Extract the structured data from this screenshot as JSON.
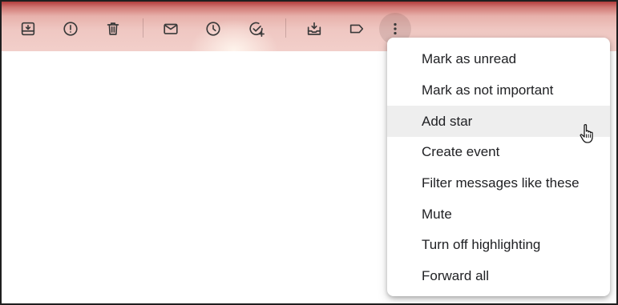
{
  "toolbar": {
    "buttons": [
      {
        "name": "archive-icon"
      },
      {
        "name": "report-spam-icon"
      },
      {
        "name": "delete-icon"
      },
      {
        "name": "mark-unread-icon"
      },
      {
        "name": "snooze-icon"
      },
      {
        "name": "add-to-tasks-icon"
      },
      {
        "name": "move-to-icon"
      },
      {
        "name": "label-icon"
      },
      {
        "name": "more-options-icon"
      }
    ]
  },
  "menu": {
    "items": [
      {
        "label": "Mark as unread"
      },
      {
        "label": "Mark as not important"
      },
      {
        "label": "Add star"
      },
      {
        "label": "Create event"
      },
      {
        "label": "Filter messages like these"
      },
      {
        "label": "Mute"
      },
      {
        "label": "Turn off highlighting"
      },
      {
        "label": "Forward all"
      }
    ],
    "hovered_index": 2
  },
  "cursor": {
    "type": "hand-pointer-icon"
  },
  "colors": {
    "toolbar_top": "#b33d3d",
    "toolbar_bottom": "#f2cfca",
    "menu_hover": "#eeeeee",
    "menu_text": "#202124"
  }
}
